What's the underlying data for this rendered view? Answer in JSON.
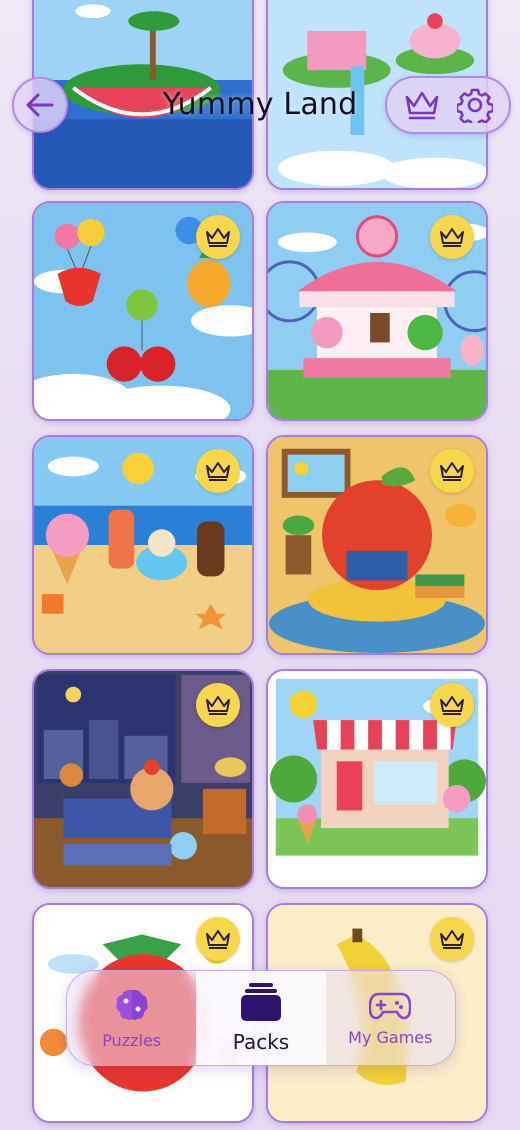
{
  "header": {
    "title": "Yummy Land",
    "back_icon": "arrow-left-icon",
    "actions": [
      {
        "name": "premium",
        "icon": "crown-icon"
      },
      {
        "name": "settings",
        "icon": "gear-icon"
      }
    ]
  },
  "puzzles": [
    {
      "id": "watermelon-island",
      "premium": false
    },
    {
      "id": "candy-island",
      "premium": false
    },
    {
      "id": "fruit-balloons",
      "premium": true
    },
    {
      "id": "candy-carousel",
      "premium": true
    },
    {
      "id": "ice-cream-beach",
      "premium": true
    },
    {
      "id": "reading-apple",
      "premium": true
    },
    {
      "id": "cupcake-bedroom",
      "premium": true
    },
    {
      "id": "candy-shop",
      "premium": true
    },
    {
      "id": "strawberry",
      "premium": true
    },
    {
      "id": "banana",
      "premium": true
    }
  ],
  "nav": {
    "items": [
      {
        "label": "Puzzles",
        "icon": "puzzle-brain-icon",
        "active": false
      },
      {
        "label": "Packs",
        "icon": "packs-stack-icon",
        "active": true
      },
      {
        "label": "My Games",
        "icon": "gamepad-icon",
        "active": false
      }
    ]
  },
  "colors": {
    "accent": "#8a43cf",
    "crown_badge": "#f7d84a",
    "tile_border": "#a77be0",
    "nav_active_icon": "#2f136d"
  }
}
